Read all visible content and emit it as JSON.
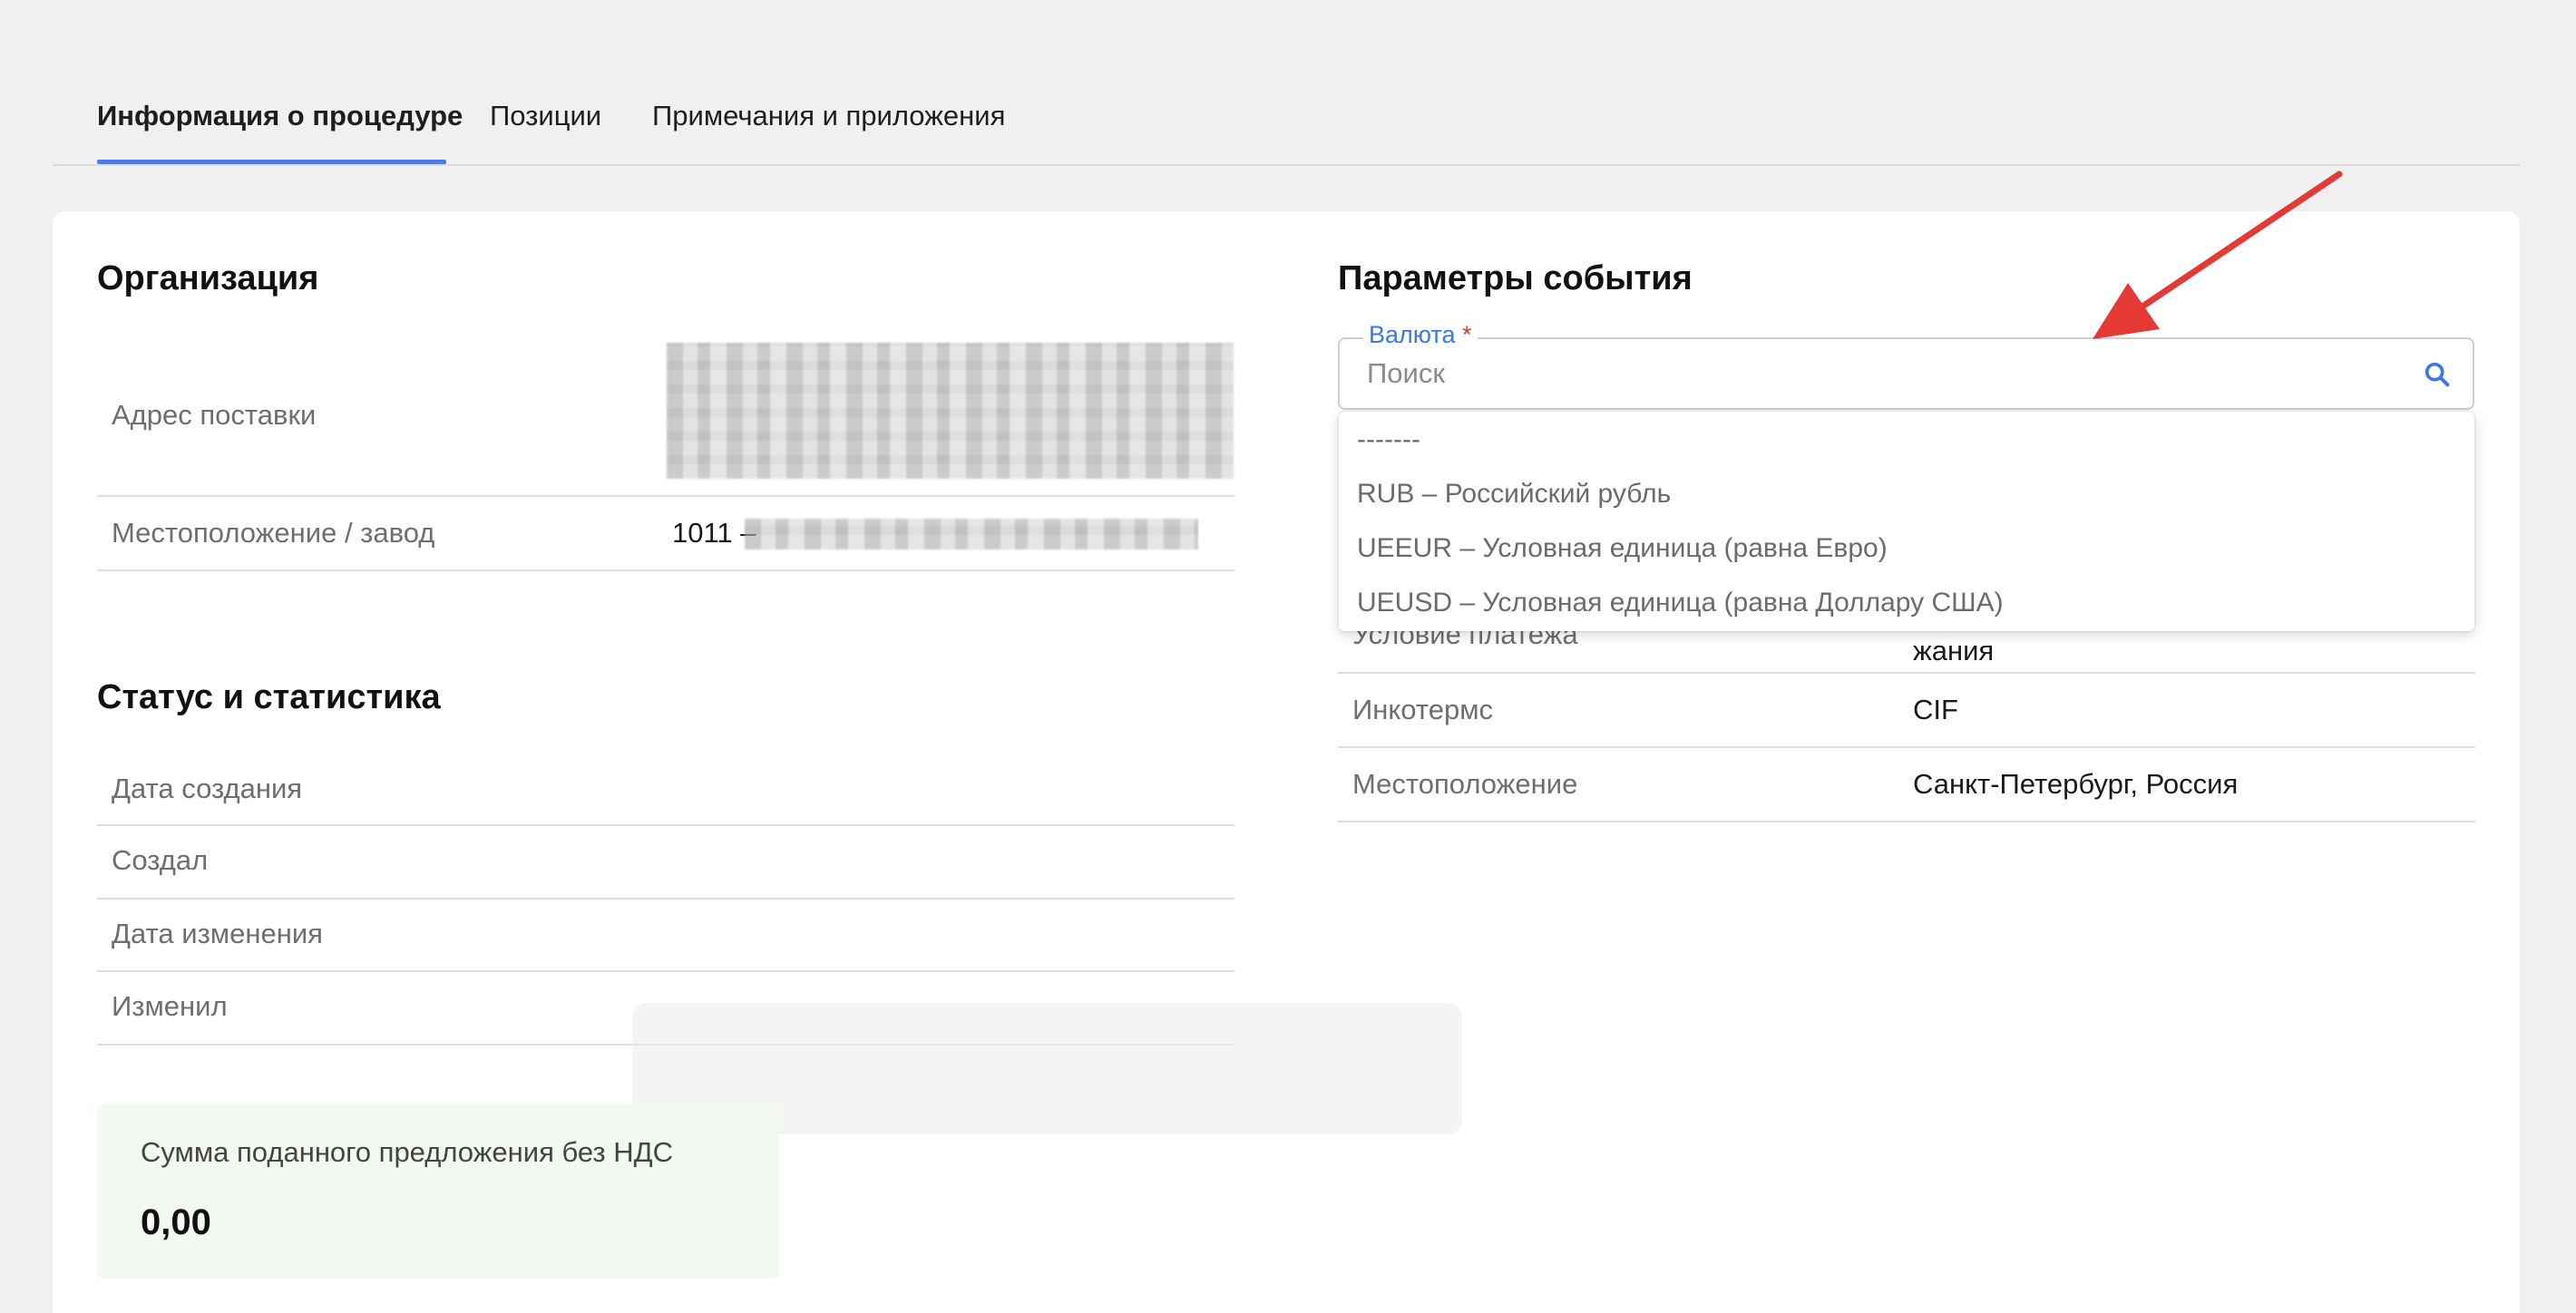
{
  "tabs": [
    {
      "label": "Информация о процедуре",
      "active": true
    },
    {
      "label": "Позиции",
      "active": false
    },
    {
      "label": "Примечания и приложения",
      "active": false
    }
  ],
  "organization": {
    "title": "Организация",
    "rows": [
      {
        "label": "Адрес поставки",
        "value": ""
      },
      {
        "label": "Местоположение / завод",
        "value": "1011 –"
      }
    ]
  },
  "status": {
    "title": "Статус и статистика",
    "rows": [
      {
        "label": "Дата создания",
        "value": ""
      },
      {
        "label": "Создал",
        "value": ""
      },
      {
        "label": "Дата изменения",
        "value": ""
      },
      {
        "label": "Изменил",
        "value": ""
      }
    ]
  },
  "summary": {
    "label": "Сумма поданного предложения без НДС",
    "value": "0,00"
  },
  "event_params": {
    "title": "Параметры события",
    "currency_field": {
      "label": "Валюта",
      "required_mark": "*",
      "placeholder": "Поиск"
    },
    "dropdown_options": [
      "-------",
      "RUB – Российский рубль",
      "UEEUR – Условная единица (равна Евро)",
      "UEUSD – Условная единица (равна Доллару США)"
    ],
    "rows": [
      {
        "label": "Условие платежа",
        "value": "жания"
      },
      {
        "label": "Инкотермс",
        "value": "CIF"
      },
      {
        "label": "Местоположение",
        "value": "Санкт-Петербург, Россия"
      }
    ]
  },
  "colors": {
    "accent": "#4d7ee6",
    "required": "#e53935",
    "annotation_arrow": "#e53935",
    "summary_bg": "#f3f9f1"
  },
  "icons": {
    "search": "search-icon",
    "annotation": "red-arrow-annotation"
  }
}
